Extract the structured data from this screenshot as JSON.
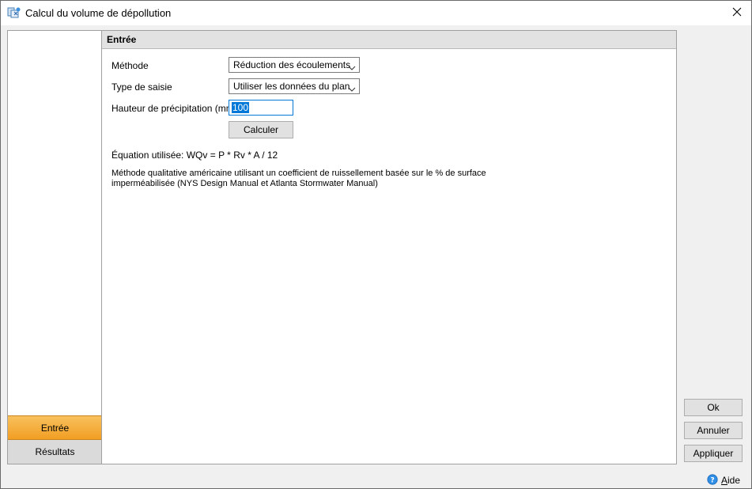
{
  "window": {
    "title": "Calcul du volume de dépollution",
    "icons": {
      "app": "app-icon",
      "close": "close-icon"
    }
  },
  "nav": {
    "items": [
      {
        "label": "Entrée",
        "active": true
      },
      {
        "label": "Résultats",
        "active": false
      }
    ]
  },
  "section": {
    "title": "Entrée"
  },
  "form": {
    "method": {
      "label": "Méthode",
      "value": "Réduction des écoulements"
    },
    "input_type": {
      "label": "Type de saisie",
      "value": "Utiliser les données du plan"
    },
    "rainfall": {
      "label": "Hauteur de précipitation (mm)",
      "value": "100"
    },
    "calculate_label": "Calculer"
  },
  "equation": "Équation utilisée: WQv = P * Rv * A / 12",
  "description": "Méthode qualitative américaine utilisant un coefficient de ruissellement basée sur le % de surface imperméabilisée (NYS Design Manual et Atlanta Stormwater Manual)",
  "buttons": {
    "ok": "Ok",
    "cancel": "Annuler",
    "apply": "Appliquer"
  },
  "help": {
    "label": "ide",
    "accel": "A",
    "icon": "help-icon"
  },
  "colors": {
    "active_tab": "#f29e23",
    "focus": "#0078d7"
  }
}
